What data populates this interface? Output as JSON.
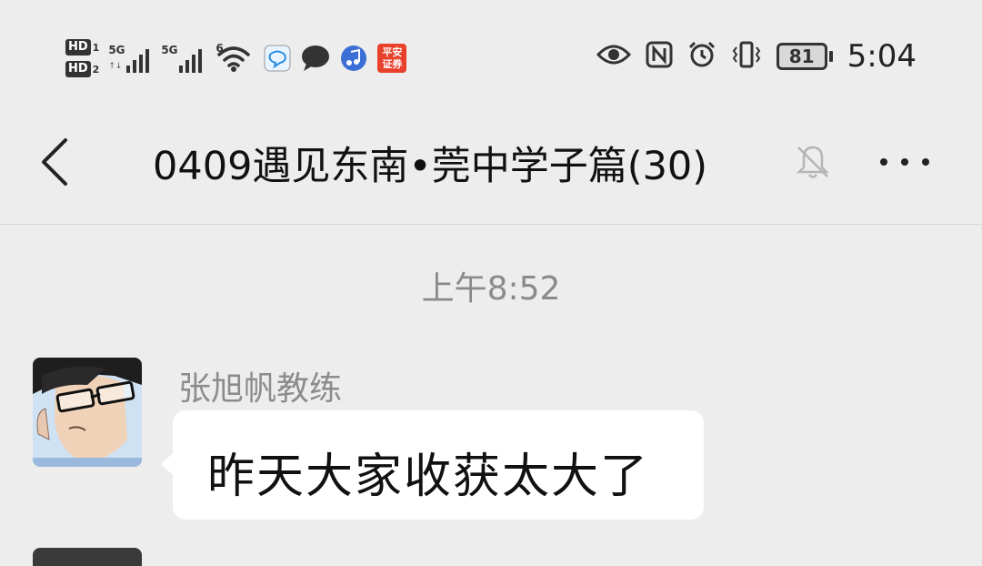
{
  "status_bar": {
    "sim1_label": "HD",
    "sim1_num": "1",
    "sim2_label": "HD",
    "sim2_num": "2",
    "network1": "5G",
    "network2": "5G",
    "wifi_gen": "6",
    "app_icons": [
      "chat-bubble-app-icon",
      "message-app-icon",
      "music-app-icon",
      "pingan-securities-app-icon"
    ],
    "pingan_text_top": "平安",
    "pingan_text_bottom": "证券",
    "right_icons": [
      "eye-icon",
      "nfc-icon",
      "alarm-icon",
      "vibrate-icon"
    ],
    "battery_level": "81",
    "time": "5:04"
  },
  "header": {
    "back_icon": "chevron-left-icon",
    "title": "0409遇见东南•莞中学子篇(30)",
    "mute_icon": "muted-bell-icon",
    "more_icon": "more-dots-icon"
  },
  "chat": {
    "timestamp": "上午8:52",
    "messages": [
      {
        "sender": "张旭帆教练",
        "text": "昨天大家收获太大了",
        "avatar_icon": "glasses-avatar"
      }
    ]
  },
  "colors": {
    "background": "#ededed",
    "bubble": "#ffffff",
    "secondary_text": "#8c8c8c"
  }
}
